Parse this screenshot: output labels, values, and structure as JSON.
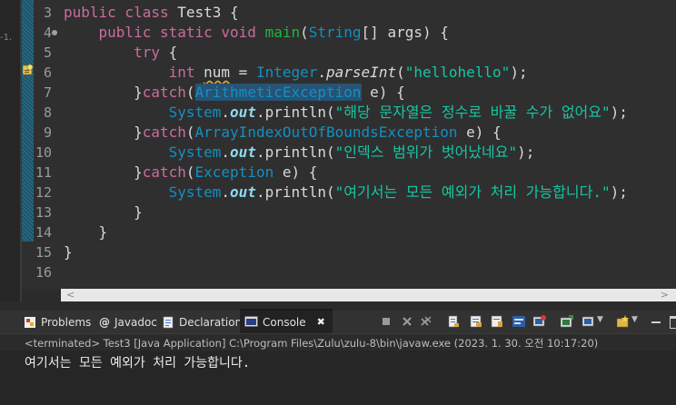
{
  "editor": {
    "gutter_marker": "-1.",
    "line_numbers": [
      "3",
      "4",
      "5",
      "6",
      "7",
      "8",
      "9",
      "10",
      "11",
      "12",
      "13",
      "14",
      "15",
      "16"
    ],
    "lines": [
      {
        "no": "3",
        "kw1": "public class ",
        "name": "Test3",
        " rest": " {"
      },
      {
        "no": "4",
        "kw1": "public static void ",
        "fn": "main",
        "p1": "(",
        "ty": "String",
        "p2": "[] ",
        "arg": "args",
        "p3": ") {"
      },
      {
        "no": "5",
        "kw": "try",
        " rest": " {"
      },
      {
        "no": "6",
        "kw": "int ",
        "var": "num",
        "eq": " = ",
        "ty": "Integer",
        "dot": ".",
        "m": "parseInt",
        "o": "(",
        "s": "\"hellohello\"",
        "c": ");"
      },
      {
        "no": "7",
        "b": "}",
        "kw": "catch",
        "o": "(",
        "ty": "ArithmeticException",
        "v": " e",
        "c": ") {"
      },
      {
        "no": "8",
        "ty": "System",
        "dot": ".",
        "f": "out",
        "dot2": ".",
        "m": "println",
        "o": "(",
        "s": "\"해당 문자열은 정수로 바꿀 수가 없어요\"",
        "c": ");"
      },
      {
        "no": "9",
        "b": "}",
        "kw": "catch",
        "o": "(",
        "ty": "ArrayIndexOutOfBoundsException",
        "v": " e",
        "c": ") {"
      },
      {
        "no": "10",
        "ty": "System",
        "dot": ".",
        "f": "out",
        "dot2": ".",
        "m": "println",
        "o": "(",
        "s": "\"인덱스 범위가 벗어났네요\"",
        "c": ");"
      },
      {
        "no": "11",
        "b": "}",
        "kw": "catch",
        "o": "(",
        "ty": "Exception",
        "v": " e",
        "c": ") {"
      },
      {
        "no": "12",
        "ty": "System",
        "dot": ".",
        "f": "out",
        "dot2": ".",
        "m": "println",
        "o": "(",
        "s": "\"여기서는 모든 예외가 처리 가능합니다.\"",
        "c": ");"
      },
      {
        "no": "13",
        "t": "}"
      },
      {
        "no": "14",
        "t": "}"
      },
      {
        "no": "15",
        "t": "}"
      },
      {
        "no": "16",
        "t": ""
      }
    ]
  },
  "panel": {
    "tabs": [
      {
        "label": "Problems",
        "icon": "problems-icon"
      },
      {
        "label": "Javadoc",
        "icon": "javadoc-icon"
      },
      {
        "label": "Declaration",
        "icon": "declaration-icon"
      },
      {
        "label": "Console",
        "icon": "console-icon",
        "close": "✖"
      }
    ],
    "status": "<terminated> Test3 [Java Application] C:\\Program Files\\Zulu\\zulu-8\\bin\\javaw.exe  (2023. 1. 30. 오전 10:17:20)",
    "output": "여기서는 모든 예외가 처리 가능합니다."
  },
  "colors": {
    "keyword": "#cc6c9c",
    "type": "#1290c3",
    "method": "#1eb540",
    "string": "#17c6a3",
    "selection": "#275374"
  }
}
